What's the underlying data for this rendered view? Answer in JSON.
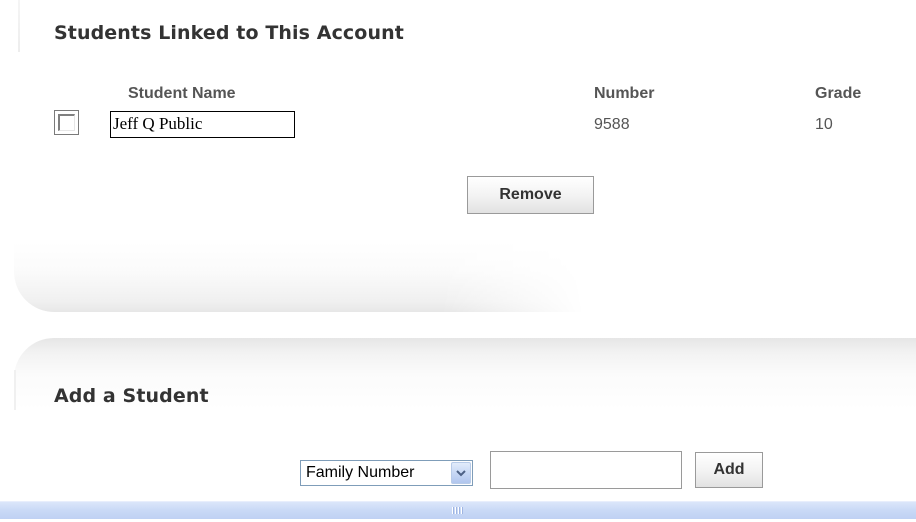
{
  "linked_section": {
    "title": "Students Linked to This Account",
    "columns": {
      "name": "Student Name",
      "number": "Number",
      "grade": "Grade"
    },
    "rows": [
      {
        "checked": false,
        "name": "Jeff Q Public",
        "number": "9588",
        "grade": "10"
      }
    ],
    "remove_label": "Remove"
  },
  "add_section": {
    "title": "Add a Student",
    "lookup_select": {
      "selected": "Family Number"
    },
    "lookup_value": "",
    "add_label": "Add"
  },
  "colors": {
    "heading": "#333333",
    "column_text": "#555555",
    "scrollbar": "#c9d9f6"
  }
}
